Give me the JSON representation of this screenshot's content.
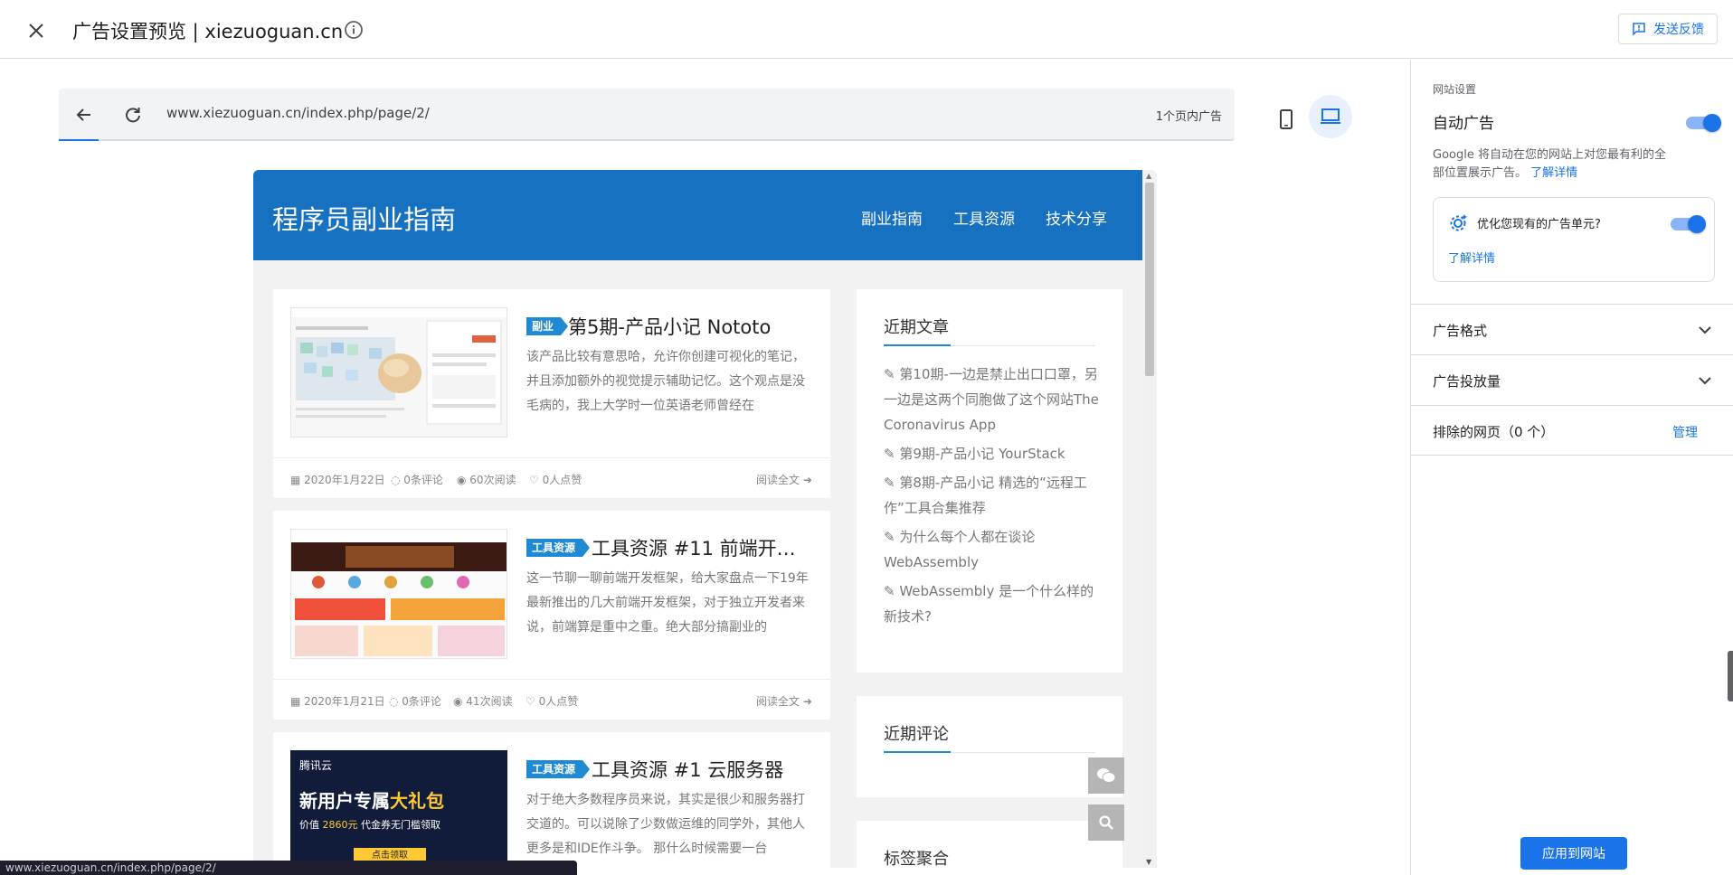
{
  "header": {
    "title": "广告设置预览 | xiezuoguan.cn",
    "feedback_label": "发送反馈"
  },
  "browser": {
    "url": "www.xiezuoguan.cn/index.php/page/2/",
    "ad_count": "1个页内广告",
    "status_url": "www.xiezuoguan.cn/index.php/page/2/"
  },
  "site": {
    "logo": "程序员副业指南",
    "nav": [
      "副业指南",
      "工具资源",
      "技术分享"
    ],
    "posts": [
      {
        "tag": "副业",
        "title": "第5期-产品小记 Nototo",
        "excerpt": "该产品比较有意思哈，允许你创建可视化的笔记，并且添加额外的视觉提示辅助记忆。这个观点是没毛病的，我上大学时一位英语老师曾经在",
        "date": "2020年1月22日",
        "comments": "0条评论",
        "views": "60次阅读",
        "likes": "0人点赞",
        "read_more": "阅读全文"
      },
      {
        "tag": "工具资源",
        "title": "工具资源 #11 前端开发…",
        "excerpt": "这一节聊一聊前端开发框架，给大家盘点一下19年最新推出的几大前端开发框架，对于独立开发者来说，前端算是重中之重。绝大部分搞副业的",
        "date": "2020年1月21日",
        "comments": "0条评论",
        "views": "41次阅读",
        "likes": "0人点赞",
        "read_more": "阅读全文"
      },
      {
        "tag": "工具资源",
        "title": "工具资源 #1 云服务器",
        "excerpt": "对于绝大多数程序员来说，其实是很少和服务器打交道的。可以说除了少数做运维的同学外，其他人更多是和IDE作斗争。 那什么时候需要一台",
        "thumb_brand": "腾讯云",
        "thumb_headline_a": "新用户专属",
        "thumb_headline_b": "大礼包",
        "thumb_sub_a": "价值",
        "thumb_sub_b": "2860元",
        "thumb_sub_c": "代金券无门槛领取",
        "thumb_cta": "点击领取"
      }
    ],
    "recent_posts_title": "近期文章",
    "recent_posts": [
      "第10期-一边是禁止出口口罩，另一边是这两个同胞做了这个网站The Coronavirus App",
      "第9期-产品小记 YourStack",
      "第8期-产品小记 精选的“远程工作”工具合集推荐",
      "为什么每个人都在谈论WebAssembly",
      "WebAssembly 是一个什么样的新技术?"
    ],
    "recent_comments_title": "近期评论",
    "tags_title": "标签聚合"
  },
  "panel": {
    "section_label": "网站设置",
    "auto_ads_title": "自动广告",
    "auto_ads_desc": "Google 将自动在您的网站上对您最有利的全部位置展示广告。",
    "learn_more": "了解详情",
    "optimize_label": "优化您现有的广告单元?",
    "optimize_learn_more": "了解详情",
    "ad_formats": "广告格式",
    "ad_load": "广告投放量",
    "excluded_pages": "排除的网页（0 个）",
    "manage": "管理",
    "apply_button": "应用到网站"
  },
  "colors": {
    "accent": "#1a73e8",
    "site_header": "#1771c1",
    "tag": "#1e8ad6"
  }
}
